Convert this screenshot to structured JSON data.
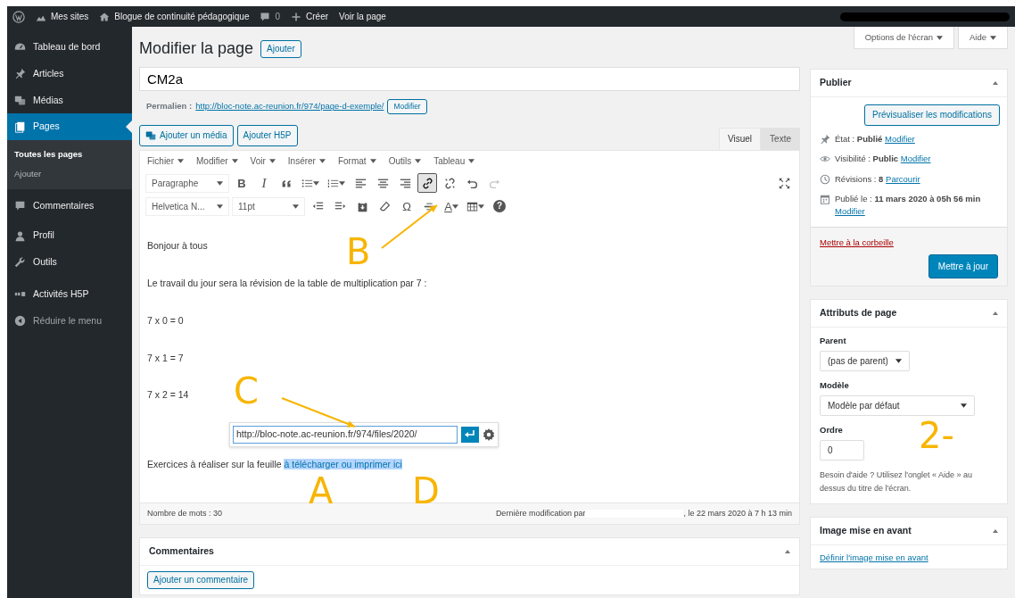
{
  "admin_bar": {
    "items": [
      {
        "kind": "wp"
      },
      {
        "kind": "sites",
        "label": "Mes sites"
      },
      {
        "kind": "home",
        "label": "Blogue de continuité pédagogique"
      },
      {
        "kind": "comment",
        "label": "0"
      },
      {
        "kind": "plus",
        "label": "Créer"
      },
      {
        "kind": "none",
        "label": "Voir la page"
      }
    ],
    "user_redacted": true
  },
  "sidebar": {
    "items": [
      {
        "kind": "dashboard",
        "label": "Tableau de bord",
        "selected": false
      },
      {
        "kind": "pin",
        "label": "Articles",
        "selected": false
      },
      {
        "kind": "media",
        "label": "Médias",
        "selected": false
      },
      {
        "kind": "pages",
        "label": "Pages",
        "selected": true,
        "submenu": [
          {
            "label": "Toutes les pages",
            "selected": true
          },
          {
            "label": "Ajouter",
            "selected": false
          }
        ]
      },
      {
        "kind": "comment",
        "label": "Commentaires",
        "selected": false
      },
      {
        "kind": "user",
        "label": "Profil",
        "selected": false
      },
      {
        "kind": "wrench",
        "label": "Outils",
        "selected": false
      },
      {
        "kind": "h5p",
        "label": "Activités H5P",
        "selected": false
      },
      {
        "kind": "collapse",
        "label": "Réduire le menu",
        "selected": false
      }
    ]
  },
  "screen_tabs": [
    "Options de l'écran",
    "Aide"
  ],
  "heading": "Modifier la page",
  "add_button": "Ajouter",
  "title_value": "CM2a",
  "permalink": {
    "label": "Permalien :",
    "url": "http://bloc-note.ac-reunion.fr/974/page-d-exemple/",
    "button": "Modifier"
  },
  "media_buttons": [
    {
      "kind": "media",
      "label": "Ajouter un média"
    },
    {
      "kind": "none",
      "label": "Ajouter H5P"
    }
  ],
  "editor_tabs": [
    {
      "label": "Visuel",
      "selected": true
    },
    {
      "label": "Texte",
      "selected": false
    }
  ],
  "menu_bar": [
    "Fichier",
    "Modifier",
    "Voir",
    "Insérer",
    "Format",
    "Outils",
    "Tableau"
  ],
  "toolbar_rows": [
    [
      {
        "kind": "select",
        "label": "Paragraphe",
        "active": false,
        "disabled": false
      },
      {
        "kind": "bold",
        "text": "B",
        "active": false,
        "disabled": false
      },
      {
        "kind": "italic",
        "text": "I",
        "active": false,
        "disabled": false
      },
      {
        "kind": "quote",
        "active": false,
        "disabled": false
      },
      {
        "kind": "bullets",
        "active": false,
        "disabled": false
      },
      {
        "kind": "numbers",
        "active": false,
        "disabled": false
      },
      {
        "kind": "align-left",
        "active": false,
        "disabled": false
      },
      {
        "kind": "align-center",
        "active": false,
        "disabled": false
      },
      {
        "kind": "align-right",
        "active": false,
        "disabled": false
      },
      {
        "kind": "link",
        "active": true,
        "disabled": false
      },
      {
        "kind": "unlink",
        "active": false,
        "disabled": false
      },
      {
        "kind": "undo",
        "active": false,
        "disabled": false
      },
      {
        "kind": "redo",
        "active": false,
        "disabled": true
      },
      {
        "kind": "fullscreen",
        "active": false,
        "disabled": false
      }
    ],
    [
      {
        "kind": "select",
        "label": "Helvetica N...",
        "active": false,
        "disabled": false
      },
      {
        "kind": "select-wide",
        "label": "11pt",
        "active": false,
        "disabled": false
      },
      {
        "kind": "outdent",
        "active": false,
        "disabled": false
      },
      {
        "kind": "indent",
        "active": false,
        "disabled": false
      },
      {
        "kind": "paste",
        "active": false,
        "disabled": false
      },
      {
        "kind": "eraser",
        "active": false,
        "disabled": false
      },
      {
        "kind": "omega",
        "text": "Ω",
        "active": false,
        "disabled": false
      },
      {
        "kind": "hr",
        "active": false,
        "disabled": false
      },
      {
        "kind": "text-color",
        "text": "A",
        "active": false,
        "disabled": false
      },
      {
        "kind": "table",
        "active": false,
        "disabled": false
      },
      {
        "kind": "help",
        "text": "?",
        "active": false,
        "disabled": false
      }
    ]
  ],
  "content": [
    {
      "kind": "text",
      "text": "Bonjour à tous"
    },
    {
      "kind": "text",
      "text": "Le travail du jour sera la révision de la table de multiplication par 7 :"
    },
    {
      "kind": "text",
      "text": "7 x 0 = 0"
    },
    {
      "kind": "text",
      "text": "7 x 1 = 7"
    },
    {
      "kind": "text",
      "text": "7 x 2 = 14"
    },
    {
      "kind": "link_popup",
      "value": "http://bloc-note.ac-reunion.fr/974/files/2020/"
    },
    {
      "kind": "selection",
      "text": "Exercices à réaliser sur la feuille ",
      "selected_text": "à télécharger ou imprimer ici"
    }
  ],
  "status": {
    "words": "Nombre de mots : 30",
    "modified_prefix": "Dernière modification par",
    "author_redacted": true,
    "modified_suffix": ", le 22 mars 2020 à 7 h 13 min"
  },
  "comments_box": {
    "title": "Commentaires",
    "button": "Ajouter un commentaire"
  },
  "publish_box": {
    "title": "Publier",
    "preview": "Prévisualiser les modifications",
    "rows": [
      {
        "kind": "pin",
        "text": "État : **Publié**",
        "link": "Modifier"
      },
      {
        "kind": "eye",
        "text": "Visibilité : **Public**",
        "link": "Modifier"
      },
      {
        "kind": "clock",
        "text": "Révisions : **8**",
        "link": "Parcourir"
      },
      {
        "kind": "calendar",
        "text": "Publié le : **11 mars 2020 à 05h 56 min**",
        "link": "Modifier"
      }
    ],
    "trash": "Mettre à la corbeille",
    "update": "Mettre à jour"
  },
  "attributes_box": {
    "title": "Attributs de page",
    "parent_label": "Parent",
    "parent_value": "(pas de parent)",
    "template_label": "Modèle",
    "template_value": "Modèle par défaut",
    "order_label": "Ordre",
    "order_value": "0",
    "help": "Besoin d'aide ? Utilisez l'onglet « Aide » au dessus du titre de l'écran."
  },
  "featured_box": {
    "title": "Image mise en avant",
    "link": "Définir l'image mise en avant"
  },
  "annotations": [
    {
      "text": "B",
      "arrow": true
    },
    {
      "text": "C",
      "arrow": true
    },
    {
      "text": "A",
      "arrow": false
    },
    {
      "text": "D",
      "arrow": false
    },
    {
      "text": "2-",
      "arrow": false
    }
  ]
}
